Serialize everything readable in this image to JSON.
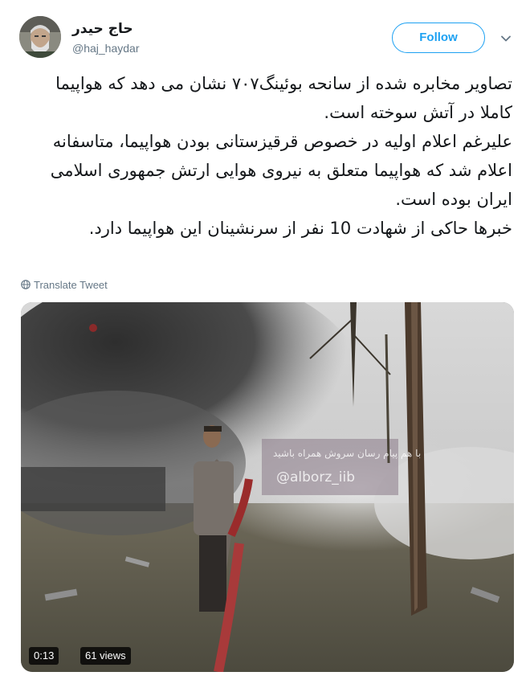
{
  "user": {
    "name": "حاج حیدر",
    "handle": "@haj_haydar",
    "avatar": "avatar"
  },
  "header": {
    "follow_label": "Follow",
    "more_icon": "chevron-down-icon"
  },
  "tweet": {
    "lines": [
      "تصاویر مخابره شده از سانحه بوئینگ۷۰۷ نشان می دهد که هواپیما کاملا در آتش سوخته است.",
      "علیرغم اعلام اولیه در خصوص قرقیزستانی بودن هواپیما، متاسفانه اعلام شد که هواپیما متعلق به نیروی هوایی ارتش جمهوری اسلامی ایران بوده است.",
      "خبرها حاکی از شهادت 10 نفر از سرنشینان این هواپیما دارد."
    ]
  },
  "translate": {
    "label": "Translate Tweet",
    "icon": "globe-icon"
  },
  "media": {
    "duration": "0:13",
    "views": "61 views",
    "overlay_line1": "با هم پیام رسان سروش همراه باشید",
    "overlay_line2": "@alborz_iib"
  },
  "colors": {
    "accent": "#1da1f2",
    "secondary_text": "#657786",
    "primary_text": "#14171a"
  }
}
